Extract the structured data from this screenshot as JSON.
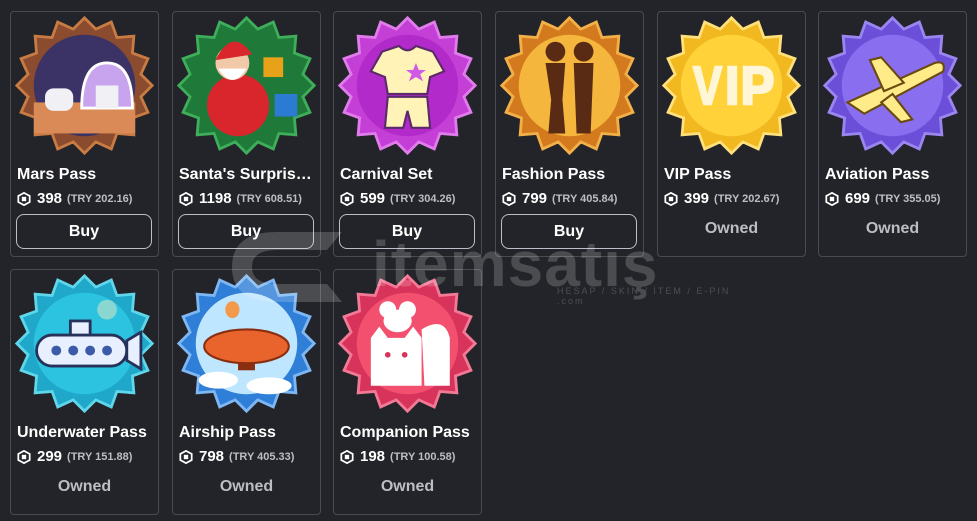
{
  "passes": [
    {
      "name": "Mars Pass",
      "robux": "398",
      "local": "(TRY 202.16)",
      "action": "Buy",
      "status": "buy",
      "icon": "mars-dome-icon"
    },
    {
      "name": "Santa's Surprise ...",
      "robux": "1198",
      "local": "(TRY 608.51)",
      "action": "Buy",
      "status": "buy",
      "icon": "santa-icon"
    },
    {
      "name": "Carnival Set",
      "robux": "599",
      "local": "(TRY 304.26)",
      "action": "Buy",
      "status": "buy",
      "icon": "carnival-outfit-icon"
    },
    {
      "name": "Fashion Pass",
      "robux": "799",
      "local": "(TRY 405.84)",
      "action": "Buy",
      "status": "buy",
      "icon": "fashion-silhouette-icon"
    },
    {
      "name": "VIP Pass",
      "robux": "399",
      "local": "(TRY 202.67)",
      "action": "Owned",
      "status": "owned",
      "icon": "vip-badge-icon"
    },
    {
      "name": "Aviation Pass",
      "robux": "699",
      "local": "(TRY 355.05)",
      "action": "Owned",
      "status": "owned",
      "icon": "airplane-icon"
    },
    {
      "name": "Underwater Pass",
      "robux": "299",
      "local": "(TRY 151.88)",
      "action": "Owned",
      "status": "owned",
      "icon": "submarine-icon"
    },
    {
      "name": "Airship Pass",
      "robux": "798",
      "local": "(TRY 405.33)",
      "action": "Owned",
      "status": "owned",
      "icon": "airship-icon"
    },
    {
      "name": "Companion Pass",
      "robux": "198",
      "local": "(TRY 100.58)",
      "action": "Owned",
      "status": "owned",
      "icon": "pets-icon"
    }
  ],
  "watermark": {
    "text": "itemsatış",
    "sub": "HESAP / SKIN / İTEM / E-PIN .com"
  },
  "colors": {
    "background": "#232429",
    "card_border": "#4a4b52",
    "muted_text": "#bdbec4"
  }
}
